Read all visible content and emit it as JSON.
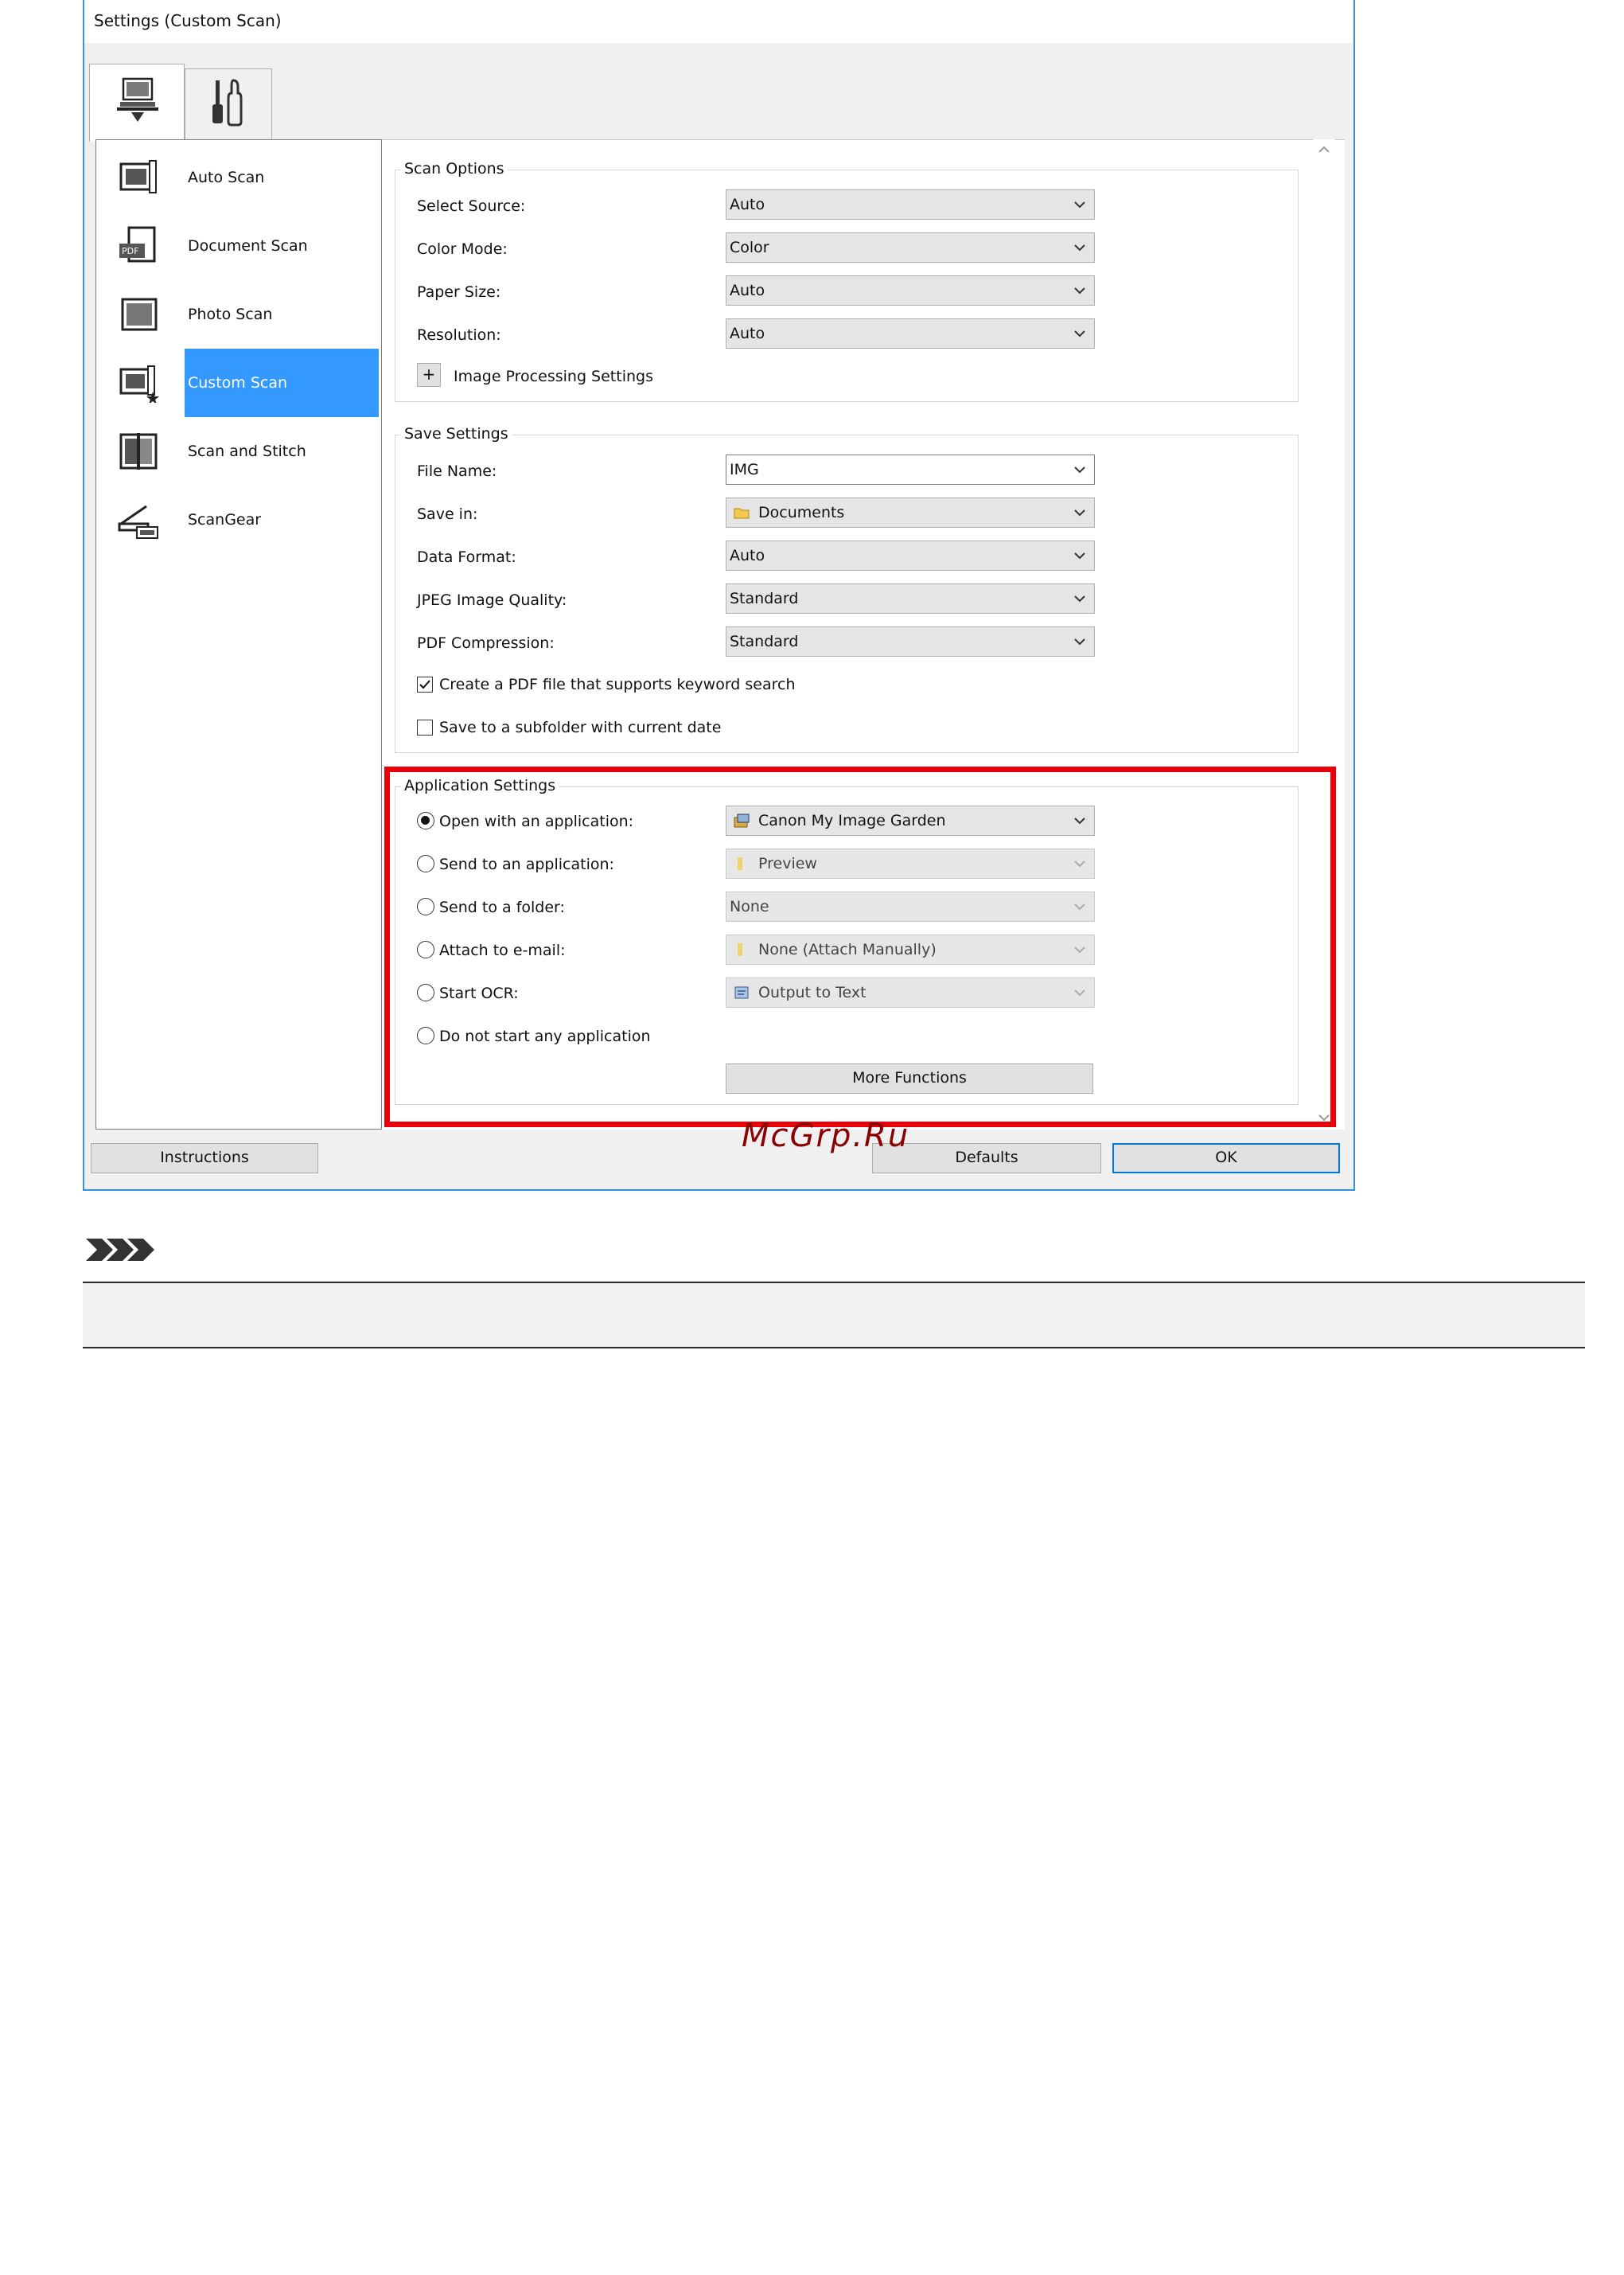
{
  "window": {
    "title": "Settings (Custom Scan)"
  },
  "tabs": [
    {
      "name": "scan-from-computer",
      "icon": "computer-scan-icon",
      "selected": true
    },
    {
      "name": "general-settings",
      "icon": "tools-icon",
      "selected": false
    }
  ],
  "modes": [
    {
      "label": "Auto Scan",
      "icon": "auto-scan-icon",
      "selected": false
    },
    {
      "label": "Document Scan",
      "icon": "document-scan-icon",
      "selected": false
    },
    {
      "label": "Photo Scan",
      "icon": "photo-scan-icon",
      "selected": false
    },
    {
      "label": "Custom Scan",
      "icon": "custom-scan-icon",
      "selected": true
    },
    {
      "label": "Scan and Stitch",
      "icon": "scan-and-stitch-icon",
      "selected": false
    },
    {
      "label": "ScanGear",
      "icon": "scangear-icon",
      "selected": false
    }
  ],
  "scan_options": {
    "title": "Scan Options",
    "rows": [
      {
        "label": "Select Source:",
        "value": "Auto"
      },
      {
        "label": "Color Mode:",
        "value": "Color"
      },
      {
        "label": "Paper Size:",
        "value": "Auto"
      },
      {
        "label": "Resolution:",
        "value": "Auto"
      }
    ],
    "expand_symbol": "+",
    "image_processing_label": "Image Processing Settings"
  },
  "save_settings": {
    "title": "Save Settings",
    "rows": [
      {
        "label": "File Name:",
        "value": "IMG"
      },
      {
        "label": "Save in:",
        "value": "Documents"
      },
      {
        "label": "Data Format:",
        "value": "Auto"
      },
      {
        "label": "JPEG Image Quality:",
        "value": "Standard"
      },
      {
        "label": "PDF Compression:",
        "value": "Standard"
      }
    ],
    "checkboxes": [
      {
        "label": "Create a PDF file that supports keyword search",
        "checked": true
      },
      {
        "label": "Save to a subfolder with current date",
        "checked": false
      }
    ]
  },
  "application_settings": {
    "title": "Application Settings",
    "options": [
      {
        "label": "Open with an application:",
        "value": "Canon My Image Garden",
        "checked": true,
        "enabled": true
      },
      {
        "label": "Send to an application:",
        "value": "Preview",
        "checked": false,
        "enabled": false
      },
      {
        "label": "Send to a folder:",
        "value": "None",
        "checked": false,
        "enabled": false
      },
      {
        "label": "Attach to e-mail:",
        "value": "None (Attach Manually)",
        "checked": false,
        "enabled": false
      },
      {
        "label": "Start OCR:",
        "value": "Output to Text",
        "checked": false,
        "enabled": false
      }
    ],
    "no_app_label": "Do not start any application",
    "more_functions_label": "More Functions"
  },
  "buttons": {
    "instructions": "Instructions",
    "defaults": "Defaults",
    "ok": "OK"
  },
  "watermark": "McGrp.Ru",
  "colors": {
    "highlight": "#e8000b",
    "selection": "#3399ff",
    "window_border": "#3b8fd9",
    "watermark": "#8b0000"
  }
}
